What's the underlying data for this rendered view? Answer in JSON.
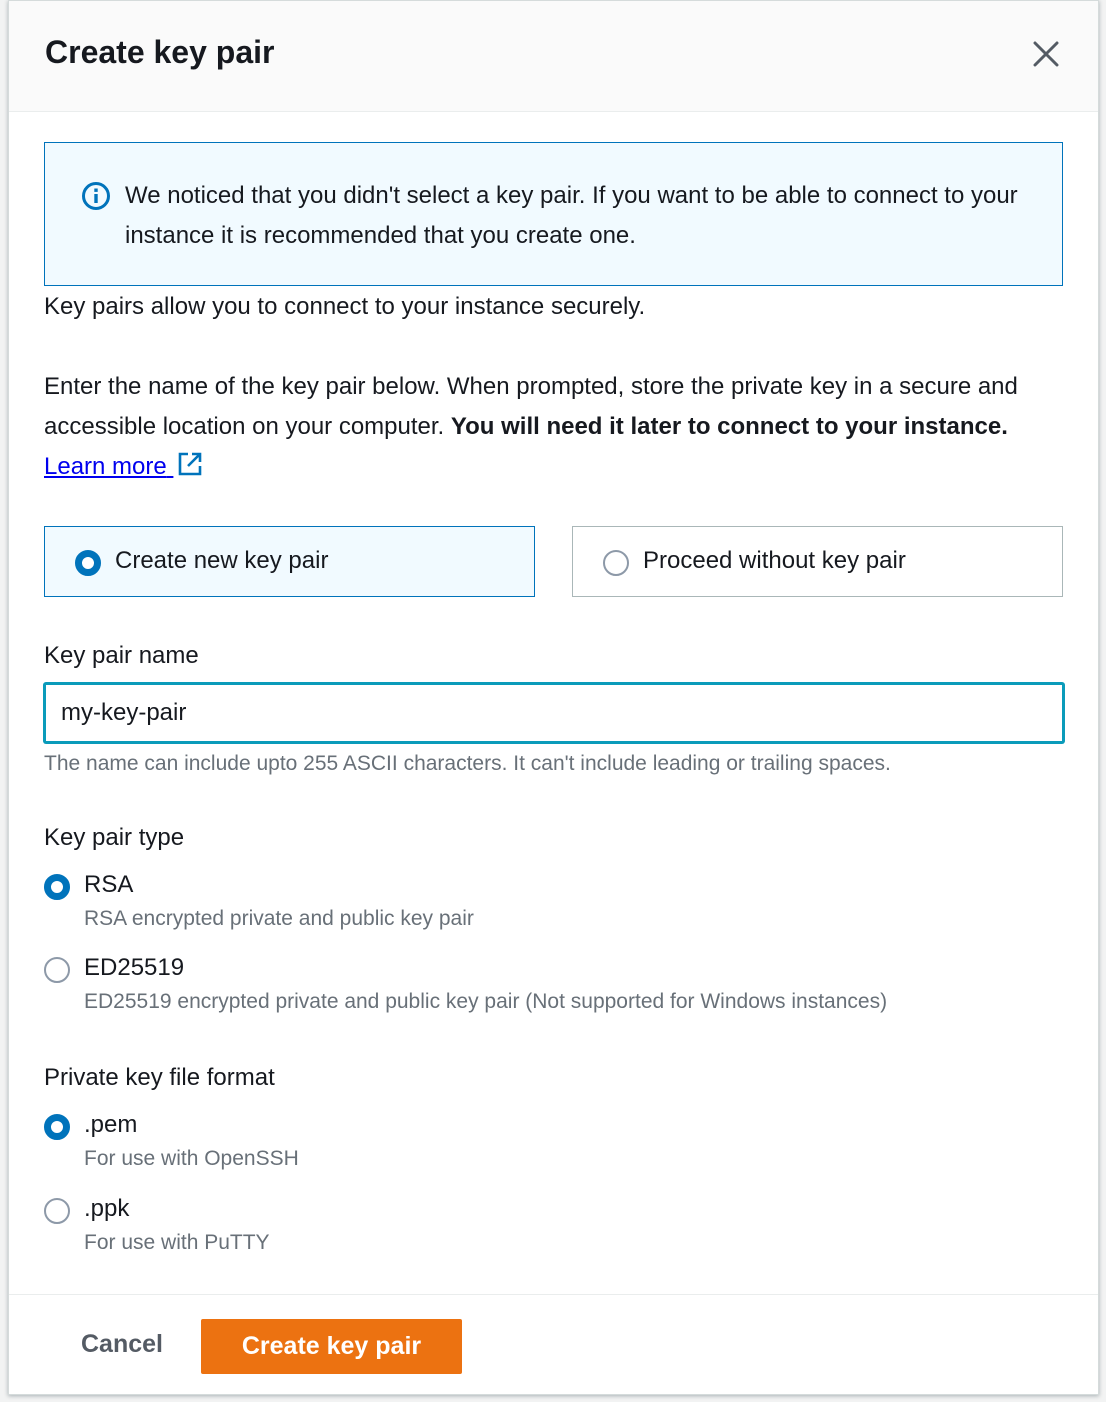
{
  "modal": {
    "title": "Create key pair",
    "close_icon": "close-icon"
  },
  "alert": {
    "icon": "info-icon",
    "text": "We noticed that you didn't select a key pair. If you want to be able to connect to your instance it is recommended that you create one."
  },
  "intro": {
    "text1": "Key pairs allow you to connect to your instance securely.",
    "text2_plain": "Enter the name of the key pair below. When prompted, store the private key in a secure and accessible location on your computer. ",
    "text2_bold": "You will need it later to connect to your instance.",
    "learn_more": "Learn more",
    "external_icon": "external-link-icon"
  },
  "choice": {
    "create_label": "Create new key pair",
    "proceed_label": "Proceed without key pair",
    "selected": "create"
  },
  "key_name": {
    "label": "Key pair name",
    "value": "my-key-pair",
    "constraint": "The name can include upto 255 ASCII characters. It can't include leading or trailing spaces."
  },
  "key_type": {
    "label": "Key pair type",
    "options": [
      {
        "label": "RSA",
        "desc": "RSA encrypted private and public key pair",
        "checked": true
      },
      {
        "label": "ED25519",
        "desc": "ED25519 encrypted private and public key pair (Not supported for Windows instances)",
        "checked": false
      }
    ]
  },
  "file_format": {
    "label": "Private key file format",
    "options": [
      {
        "label": ".pem",
        "desc": "For use with OpenSSH",
        "checked": true
      },
      {
        "label": ".ppk",
        "desc": "For use with PuTTY",
        "checked": false
      }
    ]
  },
  "footer": {
    "cancel": "Cancel",
    "create": "Create key pair"
  },
  "colors": {
    "primary_button": "#ec7211",
    "selection_blue": "#0073bb",
    "info_bg": "#f1faff",
    "focus_border": "#0a9bba"
  }
}
